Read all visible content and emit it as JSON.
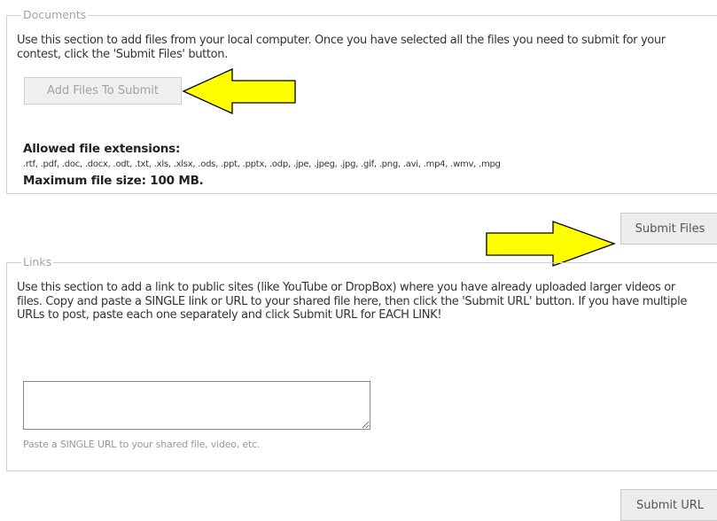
{
  "documents": {
    "legend": "Documents",
    "description": "Use this section to add files from your local computer. Once you have selected all the files you need to submit for your contest, click the 'Submit Files' button.",
    "add_files_button": "Add Files To Submit",
    "allowed_title": "Allowed file extensions:",
    "allowed_list": ".rtf, .pdf, .doc, .docx, .odt, .txt, .xls, .xlsx, .ods, .ppt, .pptx, .odp, .jpe, .jpeg, .jpg, .gif, .png, .avi, .mp4, .wmv, .mpg",
    "max_size": "Maximum file size: 100 MB."
  },
  "submit_files_button": "Submit Files",
  "links": {
    "legend": "Links",
    "description": "Use this section to add a link to public sites (like YouTube or DropBox) where you have already uploaded larger videos or files. Copy and paste a SINGLE link or URL to your shared file here, then click the 'Submit URL' button. If you have multiple URLs to post, paste each one separately and click Submit URL for EACH LINK!",
    "url_value": "",
    "url_hint": "Paste a SINGLE URL to your shared file, video, etc."
  },
  "submit_url_button": "Submit URL",
  "colors": {
    "arrow_fill": "#ffff00",
    "arrow_stroke": "#000000",
    "border": "#cfcfcf",
    "legend_text": "#a3a3a3"
  },
  "icons": [
    "arrow-left-annotation-icon",
    "arrow-right-annotation-icon"
  ]
}
